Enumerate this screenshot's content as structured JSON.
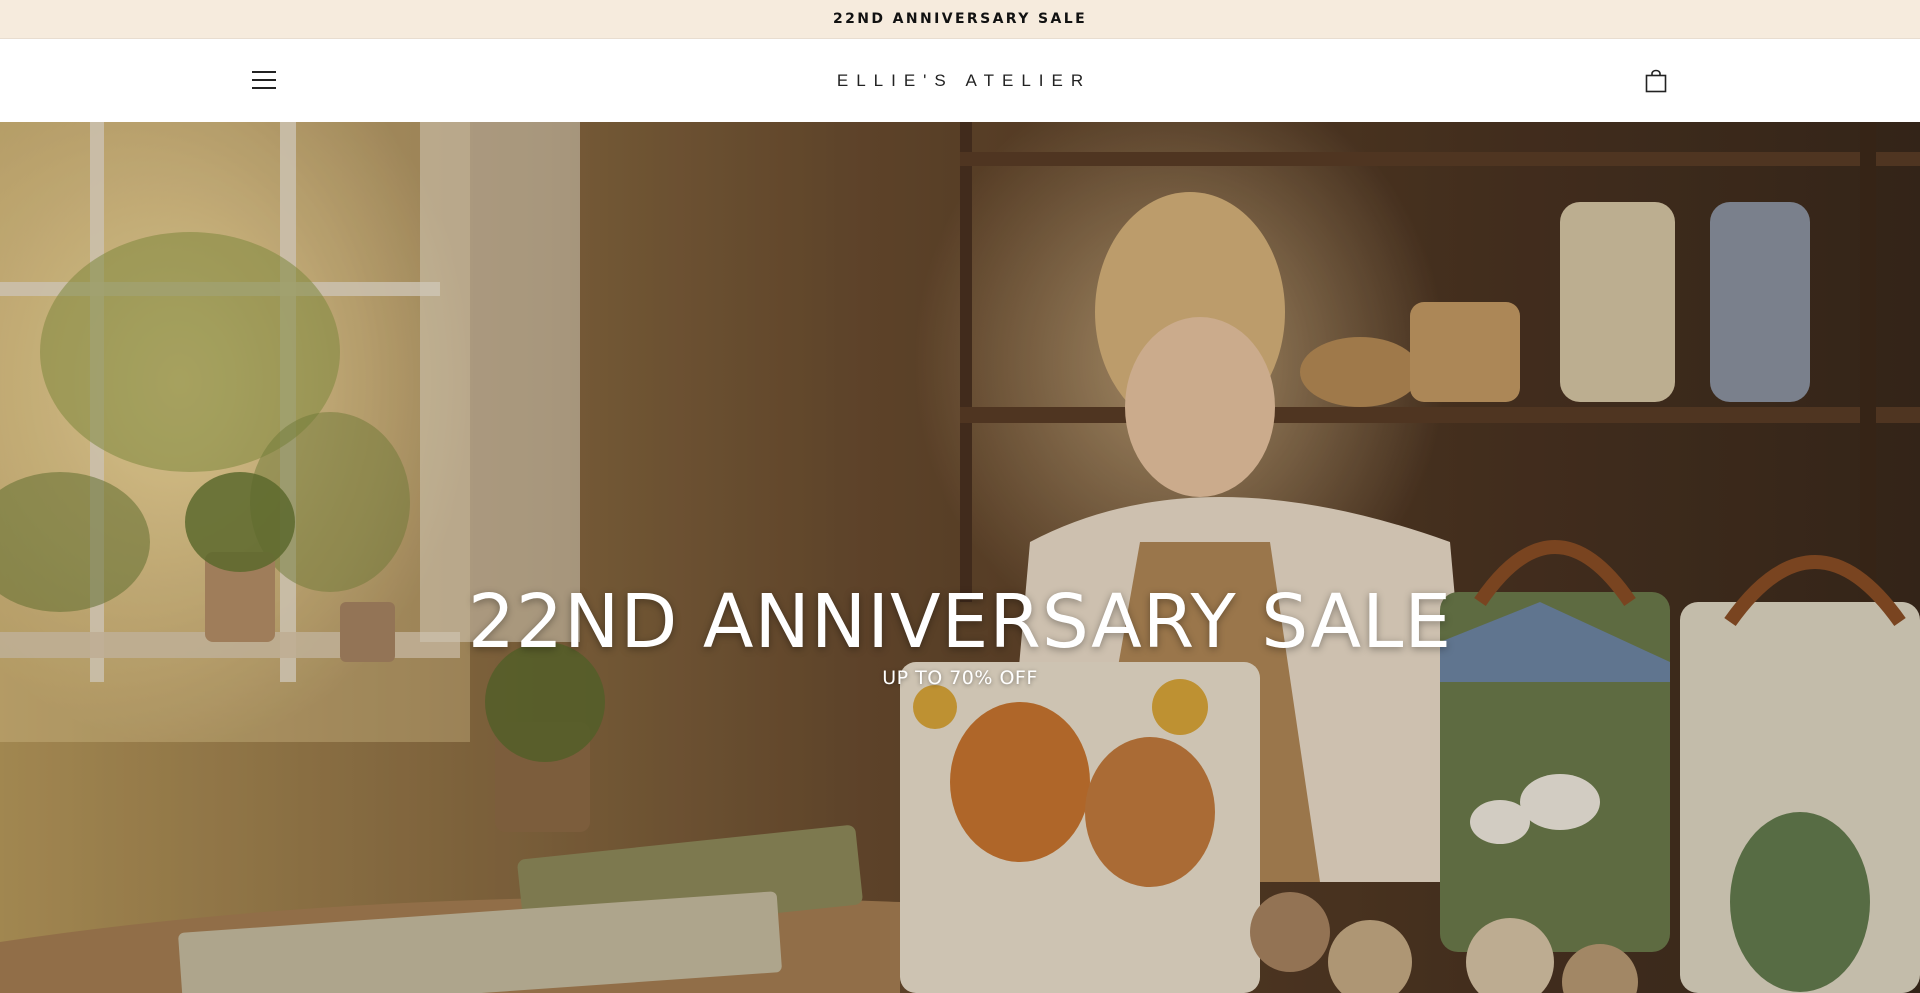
{
  "announcement": {
    "text": "22ND ANNIVERSARY SALE"
  },
  "header": {
    "logo_text": "ELLIE'S ATELIER",
    "menu_icon": "hamburger-menu-icon",
    "cart_icon": "shopping-bag-icon"
  },
  "hero": {
    "title": "22ND ANNIVERSARY SALE",
    "subtitle": "UP TO 70% OFF",
    "image_subject": "Woman sewing quilted tote bags in a sunlit craft studio"
  },
  "colors": {
    "announcement_bg": "#f6ebdd",
    "header_bg": "#ffffff",
    "hero_text": "#ffffff"
  }
}
